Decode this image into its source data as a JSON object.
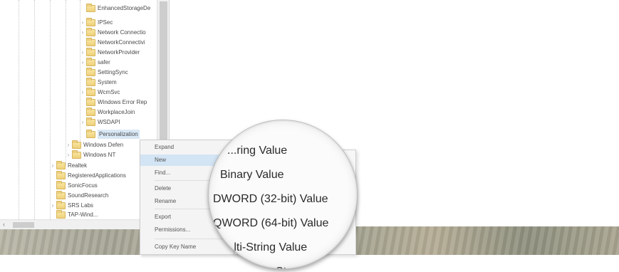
{
  "tree": {
    "items": [
      {
        "label": "EnhancedStorageDe",
        "expandable": false
      },
      {
        "label": "IPSec",
        "expandable": true
      },
      {
        "label": "Network Connectio",
        "expandable": true
      },
      {
        "label": "NetworkConnectivi",
        "expandable": false
      },
      {
        "label": "NetworkProvider",
        "expandable": true
      },
      {
        "label": "safer",
        "expandable": true
      },
      {
        "label": "SettingSync",
        "expandable": false
      },
      {
        "label": "System",
        "expandable": false
      },
      {
        "label": "WcmSvc",
        "expandable": true
      },
      {
        "label": "Windows Error Rep",
        "expandable": false
      },
      {
        "label": "WorkplaceJoin",
        "expandable": false
      },
      {
        "label": "WSDAPI",
        "expandable": true
      },
      {
        "label": "Personalization",
        "expandable": false,
        "selected": true
      },
      {
        "label": "Windows Defen",
        "expandable": true
      },
      {
        "label": "Windows NT",
        "expandable": true
      },
      {
        "label": "Realtek",
        "expandable": true
      },
      {
        "label": "RegisteredApplications",
        "expandable": false
      },
      {
        "label": "SonicFocus",
        "expandable": false
      },
      {
        "label": "SoundResearch",
        "expandable": false
      },
      {
        "label": "SRS Labs",
        "expandable": true
      },
      {
        "label": "TAP-Wind...",
        "expandable": false
      }
    ]
  },
  "context_menu": {
    "items": [
      {
        "label": "Expand",
        "highlighted": false,
        "submenu": false
      },
      {
        "label": "New",
        "highlighted": true,
        "submenu": true
      },
      {
        "label": "Find...",
        "highlighted": false,
        "submenu": false
      },
      {
        "label": "Delete",
        "highlighted": false,
        "submenu": false
      },
      {
        "label": "Rename",
        "highlighted": false,
        "submenu": false
      },
      {
        "label": "Export",
        "highlighted": false,
        "submenu": false
      },
      {
        "label": "Permissions...",
        "highlighted": false,
        "submenu": false
      },
      {
        "label": "Copy Key Name",
        "highlighted": false,
        "submenu": false
      }
    ]
  },
  "new_submenu_zoomed": {
    "items": [
      "...ring Value",
      "Binary Value",
      "DWORD (32-bit) Value",
      "QWORD (64-bit) Value",
      "...lti-String Value",
      "...able St..."
    ]
  },
  "colors": {
    "selection": "#d9e8f5",
    "menu_highlight": "#d3e4f4",
    "folder": "#eed07b"
  }
}
